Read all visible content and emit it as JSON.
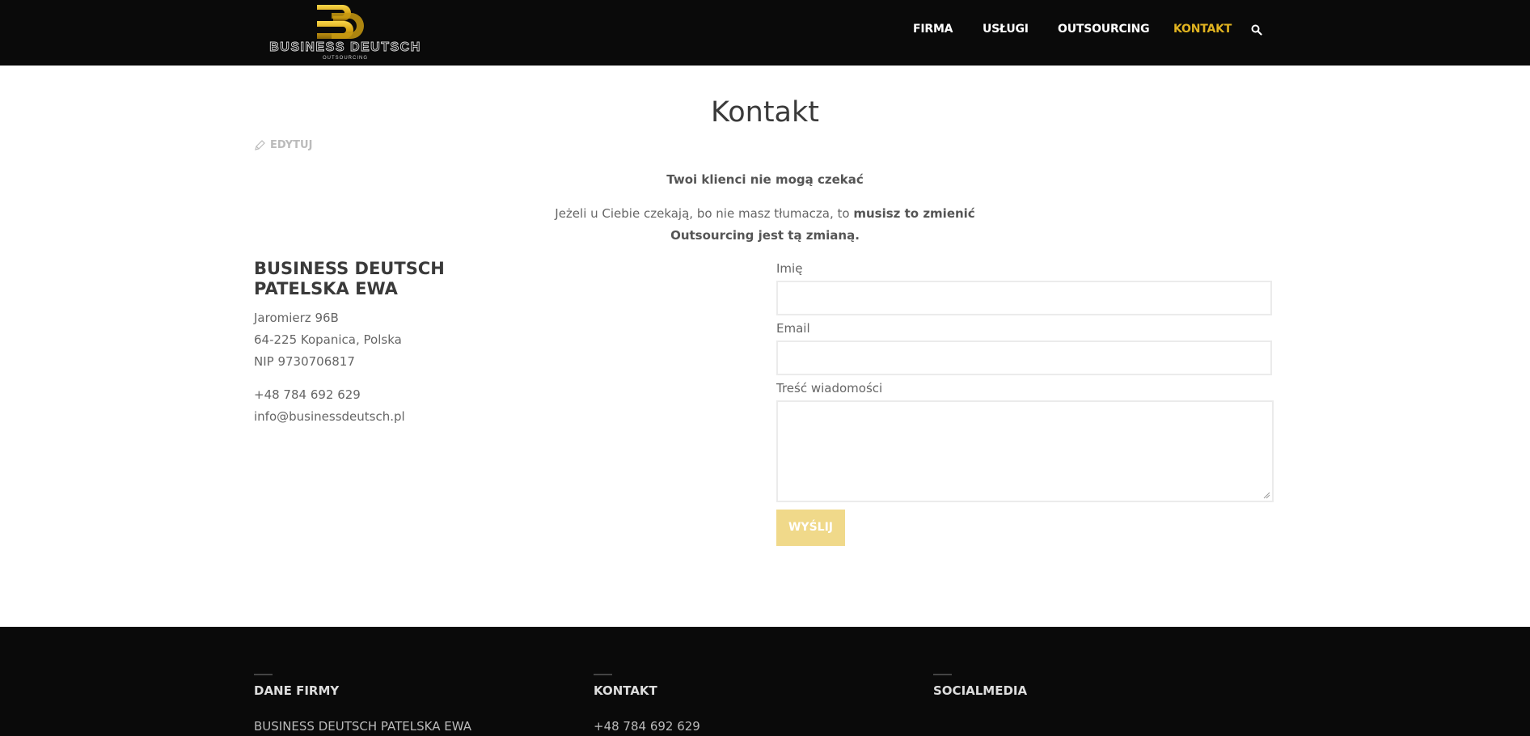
{
  "header": {
    "logo": {
      "letters": "BD",
      "name": "BUSINESS DEUTSCH",
      "tagline": "OUTSOURCING"
    },
    "nav": [
      {
        "label": "FIRMA",
        "active": false
      },
      {
        "label": "USŁUGI",
        "active": false
      },
      {
        "label": "OUTSOURCING",
        "active": false
      },
      {
        "label": "KONTAKT",
        "active": true
      }
    ],
    "search_icon": "search-icon"
  },
  "main": {
    "title": "Kontakt",
    "edit_label": "EDYTUJ",
    "intro": {
      "headline": "Twoi klienci nie mogą czekać",
      "line1_plain": "Jeżeli u Ciebie czekają, bo nie masz tłumacza, to ",
      "line1_bold": "musisz to zmienić",
      "line2_bold": "Outsourcing jest tą zmianą."
    },
    "company": {
      "name_line1": "BUSINESS DEUTSCH",
      "name_line2": "PATELSKA EWA",
      "street": "Jaromierz 96B",
      "city": "64-225 Kopanica, Polska",
      "nip": "NIP 9730706817",
      "phone": "+48 784 692 629",
      "email": "info@businessdeutsch.pl"
    },
    "form": {
      "name_label": "Imię",
      "email_label": "Email",
      "message_label": "Treść wiadomości",
      "submit_label": "WYŚLIJ"
    }
  },
  "footer": {
    "columns": [
      {
        "title": "DANE FIRMY",
        "text": "BUSINESS DEUTSCH PATELSKA EWA"
      },
      {
        "title": "KONTAKT",
        "text": "+48 784 692 629"
      },
      {
        "title": "SOCIALMEDIA",
        "text": ""
      }
    ]
  },
  "colors": {
    "accent": "#e0b320",
    "header_bg": "#0a0a0a",
    "submit_bg": "#f0d98a"
  }
}
